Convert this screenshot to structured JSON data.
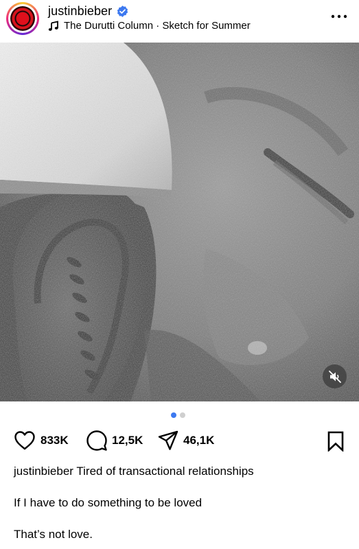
{
  "post": {
    "username": "justinbieber",
    "verified": true,
    "song": "The Durutti Column · Sketch for Summer",
    "likes": "833K",
    "comments": "12,5K",
    "shares": "46,1K",
    "caption_user": "justinbieber",
    "caption_first": "Tired of transactional relationships",
    "caption_line2": "If I have to do something to be loved",
    "caption_line3": "That’s not love.",
    "carousel": {
      "count": 2,
      "active": 1
    }
  },
  "colors": {
    "verified_badge": "#3d79f0",
    "carousel_active": "#3d79f0",
    "carousel_inactive": "#cfcfcf"
  },
  "icons": {
    "more": "more-dots-icon",
    "music": "music-note-icon",
    "like": "heart-icon",
    "comment": "comment-icon",
    "share": "paper-plane-icon",
    "save": "bookmark-icon",
    "mute": "speaker-muted-icon"
  }
}
